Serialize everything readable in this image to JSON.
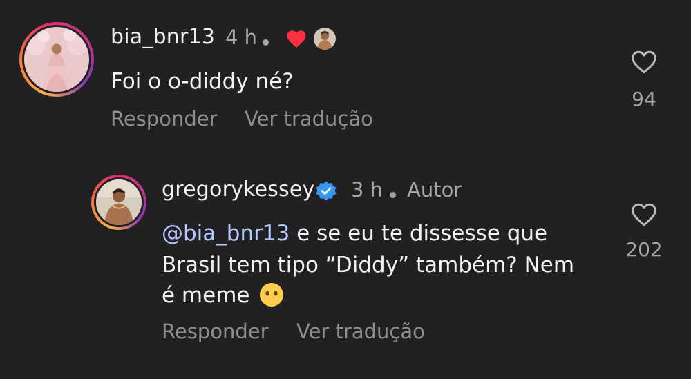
{
  "comments": [
    {
      "username": "bia_bnr13",
      "time": "4 h",
      "text": "Foi o o-diddy né?",
      "reply_label": "Responder",
      "translate_label": "Ver tradução",
      "like_count": "94",
      "liked_by_author": true
    },
    {
      "username": "gregorykessey",
      "verified": true,
      "time": "3 h",
      "author_badge": "Autor",
      "mention": "@bia_bnr13",
      "text_line1_rest": " e se eu te dissesse que",
      "text_line2": "Brasil tem tipo “Diddy” também? Nem",
      "text_line3": "é meme",
      "emoji": "face-without-mouth",
      "reply_label": "Responder",
      "translate_label": "Ver tradução",
      "like_count": "202"
    }
  ],
  "colors": {
    "background": "#212123",
    "heart_red": "#ff3040",
    "verified_blue": "#3897f0",
    "mention": "#b3c8ff"
  }
}
